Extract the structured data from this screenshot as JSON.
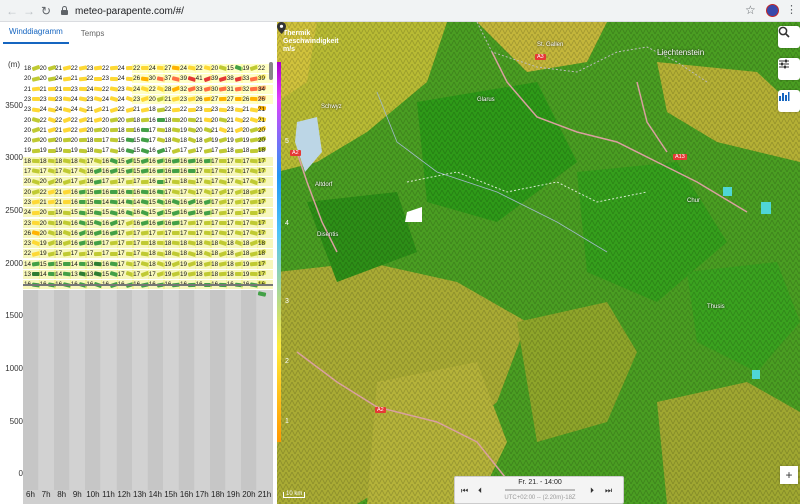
{
  "browser": {
    "url": "meteo-parapente.com/#/"
  },
  "tabs": [
    {
      "label": "Winddiagramm",
      "active": true
    },
    {
      "label": "Temps",
      "active": false
    }
  ],
  "unit_label": "(m)",
  "y_labels": [
    "3500",
    "3000",
    "2500",
    "2000",
    "1500",
    "1000",
    "500",
    "0"
  ],
  "hours": [
    "6h",
    "7h",
    "8h",
    "9h",
    "10h",
    "11h",
    "12h",
    "13h",
    "14h",
    "15h",
    "16h",
    "17h",
    "18h",
    "19h",
    "20h",
    "21h"
  ],
  "wind_rows": [
    [
      "18",
      "20",
      "21",
      "22",
      "23",
      "22",
      "24",
      "22",
      "24",
      "27",
      "24",
      "22",
      "20",
      "15",
      "19",
      "22"
    ],
    [
      "20",
      "20",
      "24",
      "21",
      "22",
      "23",
      "24",
      "26",
      "30",
      "37",
      "39",
      "41",
      "39",
      "38",
      "33",
      "39"
    ],
    [
      "21",
      "21",
      "21",
      "23",
      "24",
      "22",
      "23",
      "24",
      "22",
      "28",
      "32",
      "33",
      "30",
      "31",
      "32",
      "34"
    ],
    [
      "23",
      "23",
      "23",
      "24",
      "23",
      "24",
      "24",
      "23",
      "20",
      "21",
      "23",
      "26",
      "27",
      "27",
      "26",
      "26"
    ],
    [
      "23",
      "24",
      "24",
      "24",
      "21",
      "21",
      "22",
      "21",
      "18",
      "22",
      "22",
      "23",
      "23",
      "23",
      "21",
      "21"
    ],
    [
      "20",
      "22",
      "22",
      "22",
      "21",
      "20",
      "20",
      "18",
      "16",
      "18",
      "20",
      "21",
      "20",
      "21",
      "22",
      "21"
    ],
    [
      "20",
      "21",
      "21",
      "22",
      "20",
      "20",
      "18",
      "16",
      "17",
      "18",
      "19",
      "20",
      "21",
      "21",
      "20",
      "20"
    ],
    [
      "20",
      "20",
      "20",
      "20",
      "18",
      "17",
      "15",
      "15",
      "17",
      "18",
      "18",
      "18",
      "19",
      "19",
      "19",
      "20"
    ],
    [
      "19",
      "19",
      "19",
      "19",
      "18",
      "17",
      "16",
      "15",
      "16",
      "17",
      "17",
      "17",
      "17",
      "18",
      "18",
      "18"
    ],
    [
      "18",
      "18",
      "18",
      "18",
      "17",
      "16",
      "15",
      "15",
      "16",
      "16",
      "16",
      "16",
      "17",
      "17",
      "17",
      "17"
    ],
    [
      "17",
      "17",
      "17",
      "17",
      "16",
      "16",
      "15",
      "15",
      "16",
      "16",
      "16",
      "17",
      "17",
      "17",
      "17",
      "17"
    ],
    [
      "20",
      "20",
      "20",
      "17",
      "16",
      "17",
      "17",
      "17",
      "16",
      "17",
      "18",
      "17",
      "17",
      "17",
      "17",
      "17"
    ],
    [
      "20",
      "22",
      "21",
      "16",
      "15",
      "16",
      "16",
      "16",
      "16",
      "17",
      "17",
      "17",
      "17",
      "17",
      "18",
      "17"
    ],
    [
      "23",
      "21",
      "21",
      "16",
      "15",
      "14",
      "14",
      "14",
      "15",
      "16",
      "16",
      "16",
      "17",
      "17",
      "17",
      "17"
    ],
    [
      "24",
      "20",
      "19",
      "15",
      "15",
      "15",
      "16",
      "16",
      "15",
      "15",
      "16",
      "16",
      "17",
      "17",
      "17",
      "17"
    ],
    [
      "23",
      "20",
      "19",
      "16",
      "15",
      "16",
      "17",
      "16",
      "16",
      "16",
      "17",
      "17",
      "17",
      "17",
      "17",
      "17"
    ],
    [
      "26",
      "20",
      "18",
      "16",
      "16",
      "16",
      "17",
      "17",
      "17",
      "17",
      "17",
      "17",
      "17",
      "17",
      "17",
      "17"
    ],
    [
      "23",
      "19",
      "18",
      "16",
      "16",
      "17",
      "17",
      "17",
      "18",
      "18",
      "18",
      "18",
      "18",
      "18",
      "18",
      "18"
    ],
    [
      "22",
      "19",
      "17",
      "17",
      "17",
      "17",
      "17",
      "17",
      "18",
      "18",
      "18",
      "18",
      "18",
      "18",
      "18",
      "18"
    ],
    [
      "14",
      "15",
      "15",
      "14",
      "13",
      "16",
      "17",
      "17",
      "18",
      "19",
      "19",
      "18",
      "18",
      "18",
      "19",
      "17"
    ],
    [
      "13",
      "14",
      "14",
      "13",
      "13",
      "15",
      "17",
      "17",
      "17",
      "19",
      "19",
      "18",
      "18",
      "18",
      "19",
      "17"
    ],
    [
      "16",
      "16",
      "16",
      "16",
      "16",
      "16",
      "16",
      "16",
      "16",
      "16",
      "16",
      "16",
      "16",
      "16",
      "16",
      "16"
    ]
  ],
  "map": {
    "legend_title_line1": "Thermik",
    "legend_title_line2": "Geschwindigkeit",
    "legend_title_line3": "m/s",
    "legend_values": [
      "5",
      "4",
      "3",
      "2",
      "1"
    ],
    "places": [
      "St. Gallen",
      "Liechtenstein",
      "Schwyz",
      "Glarus",
      "Altdorf",
      "Chur",
      "Disentis",
      "Thusis"
    ],
    "roads": [
      "A3",
      "A13",
      "A2",
      "A2"
    ],
    "scale_label": "10 km",
    "player_date": "Fr. 21. - 14:00",
    "player_sub": "UTC+02:00 -- (2.20m)-18Z"
  },
  "colors": {
    "accent": "#1565c0",
    "map_green": "#3f9c1c",
    "map_yellow": "#c9c531"
  }
}
